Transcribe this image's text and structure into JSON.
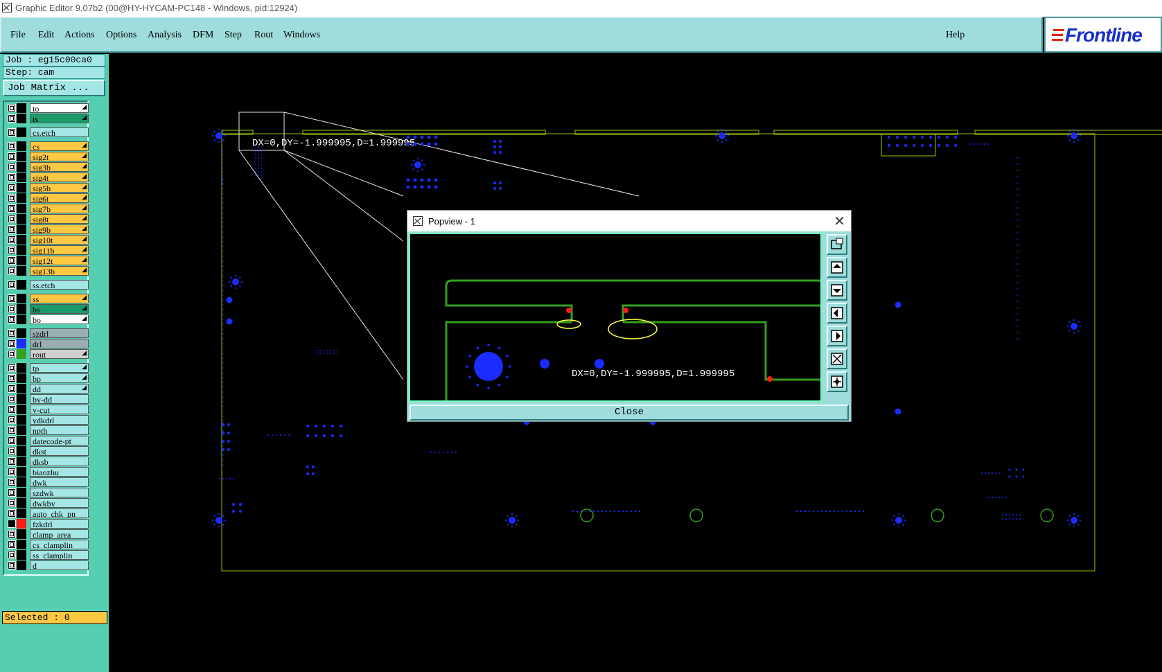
{
  "window": {
    "title": "Graphic Editor 9.07b2 (00@HY-HYCAM-PC148 - Windows, pid:12924)"
  },
  "menu": {
    "items": [
      "File",
      "Edit",
      "Actions",
      "Options",
      "Analysis",
      "DFM",
      "Step",
      "Rout",
      "Windows"
    ],
    "help": "Help"
  },
  "logo": {
    "text": "Frontline",
    "color": "#1730c8"
  },
  "panel": {
    "job": "Job : eg15c00ca0",
    "step": "Step: cam",
    "job_matrix": "Job Matrix ...",
    "selected": "Selected : 0"
  },
  "layers": [
    {
      "name": "to",
      "bg": "#ffffff",
      "swatch": "#000000",
      "arrow": true
    },
    {
      "name": "ts",
      "bg": "#1c9a6a",
      "swatch": "#000000",
      "arrow": true
    },
    {
      "name": "cs.etch",
      "bg": "#a4e6e6",
      "swatch": "#000000",
      "arrow": false
    },
    {
      "name": "cs",
      "bg": "#ffc843",
      "swatch": "#000000",
      "arrow": true
    },
    {
      "name": "sig2t",
      "bg": "#ffc843",
      "swatch": "#000000",
      "arrow": true
    },
    {
      "name": "sig3b",
      "bg": "#ffc843",
      "swatch": "#000000",
      "arrow": true
    },
    {
      "name": "sig4t",
      "bg": "#ffc843",
      "swatch": "#000000",
      "arrow": true
    },
    {
      "name": "sig5b",
      "bg": "#ffc843",
      "swatch": "#000000",
      "arrow": true
    },
    {
      "name": "sig6t",
      "bg": "#ffc843",
      "swatch": "#000000",
      "arrow": true
    },
    {
      "name": "sig7b",
      "bg": "#ffc843",
      "swatch": "#000000",
      "arrow": true
    },
    {
      "name": "sig8t",
      "bg": "#ffc843",
      "swatch": "#000000",
      "arrow": true
    },
    {
      "name": "sig9b",
      "bg": "#ffc843",
      "swatch": "#000000",
      "arrow": true
    },
    {
      "name": "sig10t",
      "bg": "#ffc843",
      "swatch": "#000000",
      "arrow": true
    },
    {
      "name": "sig11b",
      "bg": "#ffc843",
      "swatch": "#000000",
      "arrow": true
    },
    {
      "name": "sig12t",
      "bg": "#ffc843",
      "swatch": "#000000",
      "arrow": true
    },
    {
      "name": "sig13b",
      "bg": "#ffc843",
      "swatch": "#000000",
      "arrow": true
    },
    {
      "name": "ss.etch",
      "bg": "#a4e6e6",
      "swatch": "#000000",
      "arrow": false
    },
    {
      "name": "ss",
      "bg": "#ffc843",
      "swatch": "#000000",
      "arrow": true
    },
    {
      "name": "bs",
      "bg": "#1c9a6a",
      "swatch": "#000000",
      "arrow": true
    },
    {
      "name": "bo",
      "bg": "#ffffff",
      "swatch": "#000000",
      "arrow": true
    },
    {
      "name": "szdrl",
      "bg": "#9aaeb4",
      "swatch": "#000000",
      "arrow": false
    },
    {
      "name": "drl",
      "bg": "#9aaeb4",
      "swatch": "#1a2cff",
      "arrow": false
    },
    {
      "name": "rout",
      "bg": "#d0d0d0",
      "swatch": "#36a01e",
      "arrow": true
    },
    {
      "name": "tp",
      "bg": "#a4e6e6",
      "swatch": "#000000",
      "arrow": true
    },
    {
      "name": "bp",
      "bg": "#a4e6e6",
      "swatch": "#000000",
      "arrow": true
    },
    {
      "name": "dd",
      "bg": "#a4e6e6",
      "swatch": "#000000",
      "arrow": true
    },
    {
      "name": "by-dd",
      "bg": "#a4e6e6",
      "swatch": "#000000",
      "arrow": false
    },
    {
      "name": "v-cut",
      "bg": "#a4e6e6",
      "swatch": "#000000",
      "arrow": false
    },
    {
      "name": "ydkdrl",
      "bg": "#a4e6e6",
      "swatch": "#000000",
      "arrow": false
    },
    {
      "name": "npth",
      "bg": "#a4e6e6",
      "swatch": "#000000",
      "arrow": false
    },
    {
      "name": "datecode-pt",
      "bg": "#a4e6e6",
      "swatch": "#000000",
      "arrow": false
    },
    {
      "name": "dkst",
      "bg": "#a4e6e6",
      "swatch": "#000000",
      "arrow": false
    },
    {
      "name": "dksb",
      "bg": "#a4e6e6",
      "swatch": "#000000",
      "arrow": false
    },
    {
      "name": "biaozhu",
      "bg": "#a4e6e6",
      "swatch": "#000000",
      "arrow": false
    },
    {
      "name": "dwk",
      "bg": "#a4e6e6",
      "swatch": "#000000",
      "arrow": false
    },
    {
      "name": "szdwk",
      "bg": "#a4e6e6",
      "swatch": "#000000",
      "arrow": false
    },
    {
      "name": "dwkby",
      "bg": "#a4e6e6",
      "swatch": "#000000",
      "arrow": false
    },
    {
      "name": "auto_chk_pn",
      "bg": "#a4e6e6",
      "swatch": "#000000",
      "arrow": false
    },
    {
      "name": "fzkdrl",
      "bg": "#a4e6e6",
      "swatch": "#ff1a1a",
      "arrow": false,
      "checked": true
    },
    {
      "name": "clamp_area",
      "bg": "#a4e6e6",
      "swatch": "#000000",
      "arrow": false
    },
    {
      "name": "cs_clamplin",
      "bg": "#a4e6e6",
      "swatch": "#000000",
      "arrow": false
    },
    {
      "name": "ss_clamplin",
      "bg": "#a4e6e6",
      "swatch": "#000000",
      "arrow": false
    },
    {
      "name": "d",
      "bg": "#a4e6e6",
      "swatch": "#000000",
      "arrow": false
    }
  ],
  "canvas": {
    "measure_text": "DX=0,DY=-1.999995,D=1.999995"
  },
  "popview": {
    "title": "Popview - 1",
    "measure_text": "DX=0,DY=-1.999995,D=1.999995",
    "close_label": "Close",
    "tools": [
      "zoom-box-icon",
      "pan-up-icon",
      "pan-down-icon",
      "pan-left-icon",
      "pan-right-icon",
      "zoom-fit-icon",
      "zoom-center-icon"
    ]
  },
  "colors": {
    "board_outline": "#9bc400",
    "drill": "#1a2cff",
    "rout": "#36a01e",
    "highlight": "#ffff40",
    "marker": "#ff1a1a"
  }
}
